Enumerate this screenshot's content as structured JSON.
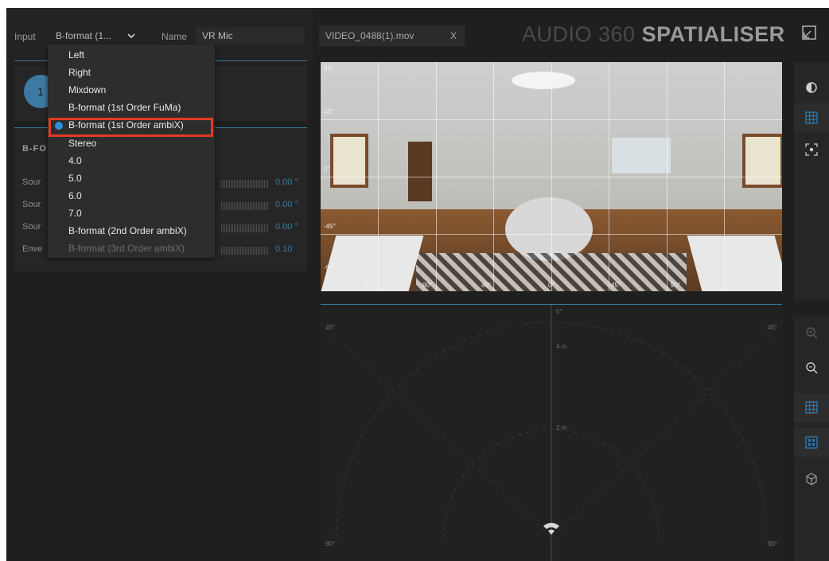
{
  "header": {
    "input_label": "Input",
    "input_value": "B-format (1...",
    "name_label": "Name",
    "name_value": "VR Mic",
    "video_tab": "VIDEO_0488(1).mov",
    "video_close": "X",
    "brand_light": "AUDIO 360",
    "brand_bold": "SPATIALISER"
  },
  "track": {
    "number": "1"
  },
  "bformat_panel": {
    "title": "B-FO",
    "rows": [
      {
        "label": "Sour",
        "value": "0.00 °"
      },
      {
        "label": "Sour",
        "value": "0.00 °"
      },
      {
        "label": "Sour",
        "value": "0.00 °"
      },
      {
        "label": "Enve",
        "value": "0.10"
      }
    ]
  },
  "dropdown": {
    "options": [
      {
        "label": "Left"
      },
      {
        "label": "Right"
      },
      {
        "label": "Mixdown"
      },
      {
        "label": "B-format (1st Order FuMa)"
      },
      {
        "label": "B-format (1st Order ambiX)"
      },
      {
        "label": "Stereo"
      },
      {
        "label": "4.0"
      },
      {
        "label": "5.0"
      },
      {
        "label": "6.0"
      },
      {
        "label": "7.0"
      },
      {
        "label": "B-format (2nd Order ambiX)"
      },
      {
        "label": "B-format (3rd Order ambiX)"
      }
    ],
    "selected_label": "B-format (1st Order ambiX)"
  },
  "video_view": {
    "tick_labels": [
      "90°",
      "45°",
      "0°",
      "-45°",
      "-90°"
    ],
    "bottom_ticks": [
      "-135°",
      "90°",
      "45°",
      "0°",
      "45°",
      "90°",
      "135°"
    ]
  },
  "radar": {
    "top_label": "0°",
    "left_label": "45°",
    "right_label": "45°",
    "ring_4m": "4 m",
    "ring_2m": "2 m",
    "bottom_left": "90°",
    "bottom_right": "90°"
  },
  "toolbar": {
    "top_icons": [
      "contrast-icon",
      "grid-icon",
      "focus-icon"
    ],
    "bottom_icons": [
      "zoom-in-icon",
      "zoom-out-icon",
      "grid-icon",
      "dots-grid-icon",
      "cube-icon"
    ]
  },
  "colors": {
    "accent": "#3d7aa3",
    "selection_outline": "#e23b25",
    "background": "#1f1f1f"
  }
}
